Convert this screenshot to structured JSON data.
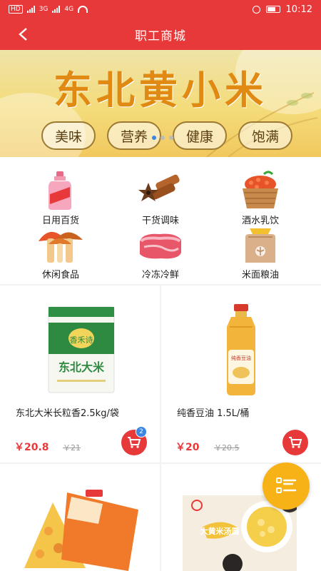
{
  "status_bar": {
    "left_labels": [
      "HD",
      "3G",
      "4G"
    ],
    "time": "10:12"
  },
  "header": {
    "title": "职工商城"
  },
  "banner": {
    "headline": "东北黄小米",
    "chips": [
      "美味",
      "营养",
      "健康",
      "饱满"
    ],
    "page_count": 3,
    "active_page": 1
  },
  "categories": [
    {
      "label": "日用百货",
      "icon": "daily-goods-icon"
    },
    {
      "label": "干货调味",
      "icon": "spices-icon"
    },
    {
      "label": "酒水乳饮",
      "icon": "drinks-icon"
    },
    {
      "label": "休闲食品",
      "icon": "snacks-icon"
    },
    {
      "label": "冷冻冷鲜",
      "icon": "frozen-meat-icon"
    },
    {
      "label": "米面粮油",
      "icon": "grain-oil-icon"
    }
  ],
  "products": [
    {
      "name": "东北大米长粒香2.5kg/袋",
      "price": "￥20.8",
      "old_price": "￥21",
      "cart_count": "2",
      "pack_brand": "香禾诗",
      "pack_title": "东北大米"
    },
    {
      "name": "纯香豆油 1.5L/桶",
      "price": "￥20",
      "old_price": "￥20.5",
      "cart_count": "",
      "pack_brand": "纯香豆油"
    },
    {
      "name": "",
      "price": "",
      "old_price": "",
      "pack_brand": ""
    },
    {
      "name": "",
      "price": "",
      "old_price": "",
      "pack_brand": "大黄米汤圆"
    }
  ],
  "colors": {
    "primary": "#e8393a",
    "fab": "#f7b217",
    "badge": "#3a86e0"
  }
}
